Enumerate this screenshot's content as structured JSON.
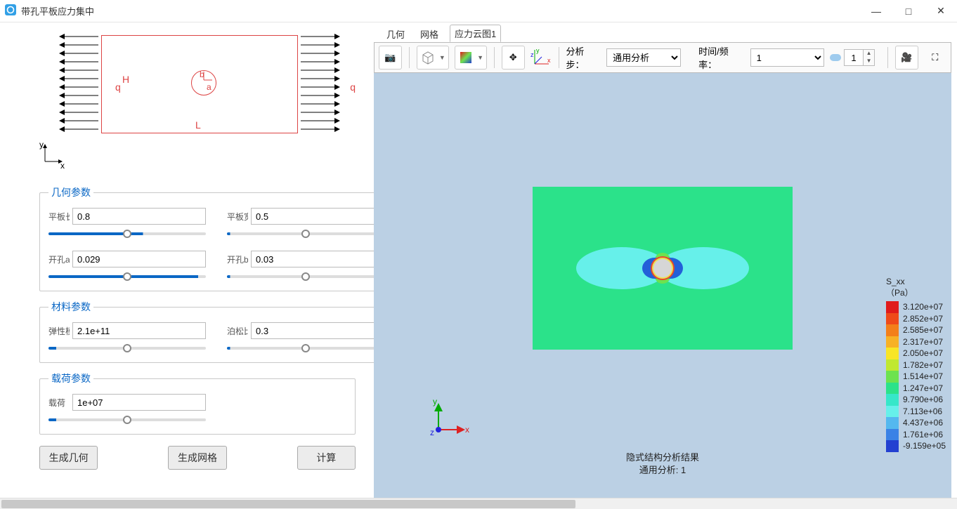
{
  "window": {
    "title": "带孔平板应力集中"
  },
  "diagram": {
    "q": "q",
    "H": "H",
    "L": "L",
    "a": "a",
    "b": "b",
    "x": "x",
    "y": "y"
  },
  "groups": {
    "geom": {
      "legend": "几何参数",
      "plate_length_label": "平板长",
      "plate_length_value": "0.8",
      "plate_width_label": "平板宽",
      "plate_width_value": "0.5",
      "hole_a_label": "开孔a",
      "hole_a_value": "0.029",
      "hole_b_label": "开孔b",
      "hole_b_value": "0.03"
    },
    "mat": {
      "legend": "材料参数",
      "E_label": "弹性模",
      "E_value": "2.1e+11",
      "nu_label": "泊松比",
      "nu_value": "0.3"
    },
    "load": {
      "legend": "载荷参数",
      "q_label": "载荷",
      "q_value": "1e+07"
    }
  },
  "buttons": {
    "gen_geom": "生成几何",
    "gen_mesh": "生成网格",
    "compute": "计算"
  },
  "tabs": {
    "geom": "几何",
    "mesh": "网格",
    "stress": "应力云图1"
  },
  "toolbar": {
    "step_label": "分析步：",
    "step_value": "通用分析",
    "time_label": "时间/频率：",
    "time_value": "1",
    "spinner_value": "1"
  },
  "result": {
    "line1": "隐式结构分析结果",
    "line2": "通用分析: 1",
    "legend_title1": "S_xx",
    "legend_title2": "（Pa）",
    "values": [
      "3.120e+07",
      "2.852e+07",
      "2.585e+07",
      "2.317e+07",
      "2.050e+07",
      "1.782e+07",
      "1.514e+07",
      "1.247e+07",
      "9.790e+06",
      "7.113e+06",
      "4.437e+06",
      "1.761e+06",
      "-9.159e+05"
    ],
    "colors": [
      "#e01b1b",
      "#ef4a1a",
      "#f37f1a",
      "#f7b126",
      "#f8e526",
      "#c0e830",
      "#6de24f",
      "#2be28a",
      "#36e7c9",
      "#66f0ea",
      "#54b8ef",
      "#3a82e6",
      "#2340d1"
    ]
  },
  "triad": {
    "x": "x",
    "y": "y",
    "z": "z"
  }
}
